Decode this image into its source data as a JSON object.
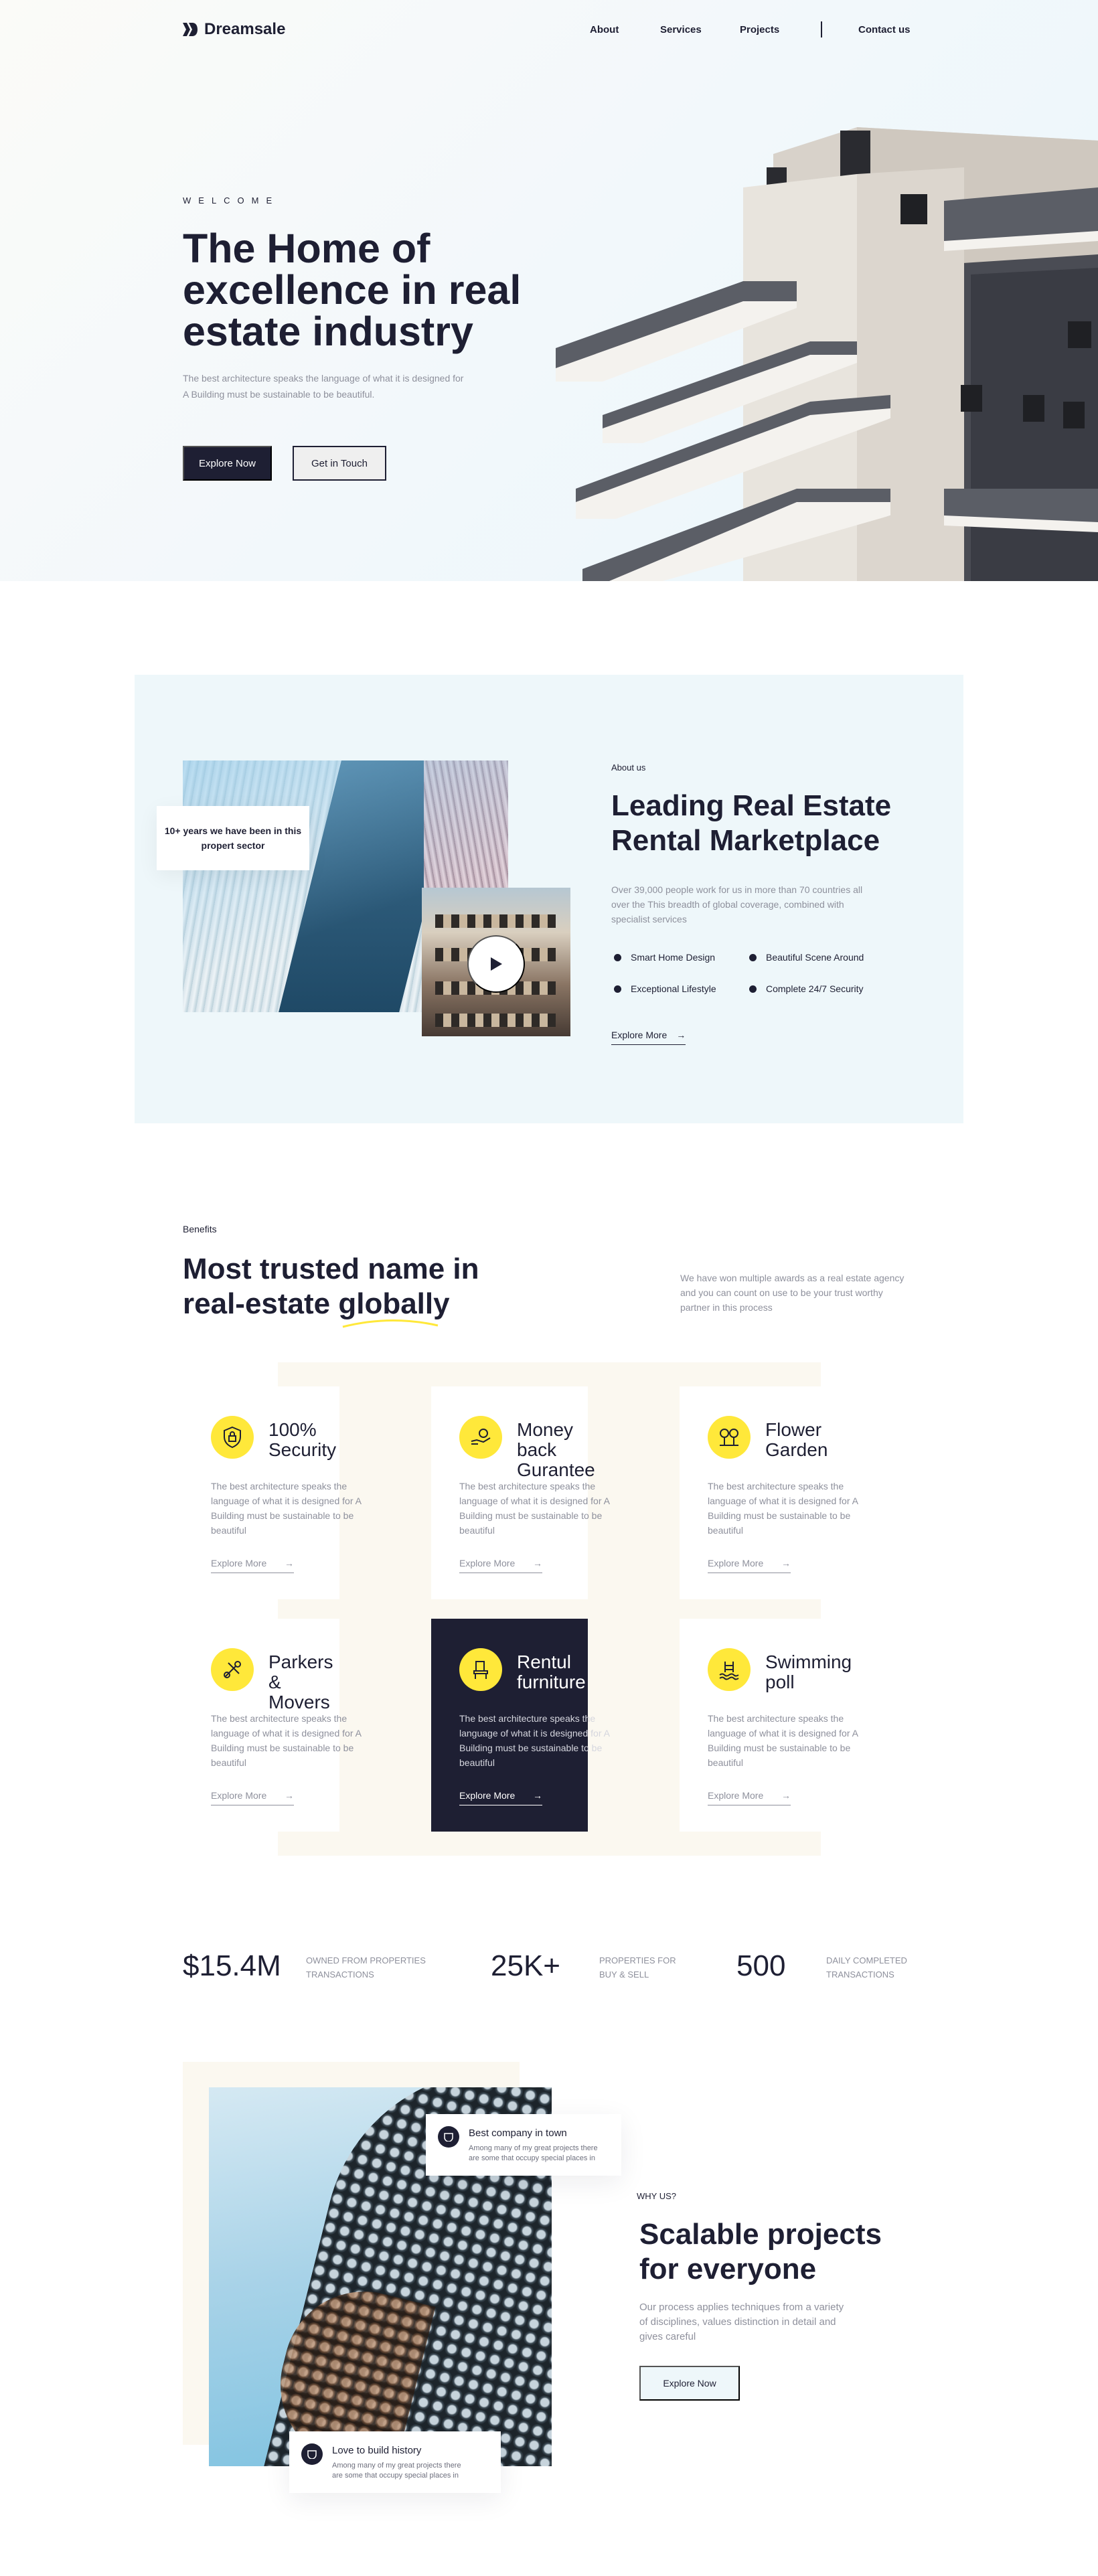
{
  "nav": {
    "brand": "Dreamsale",
    "links": [
      "About",
      "Services",
      "Projects"
    ],
    "contact": "Contact us"
  },
  "hero": {
    "eyebrow": "WELCOME",
    "title": "The Home of excellence in real estate industry",
    "subtitle": "The best architecture speaks the language of what it is designed for A Building must be sustainable to be beautiful.",
    "primary_button": "Explore Now",
    "secondary_button": "Get in Touch"
  },
  "about": {
    "badge": "10+ years we have been in this propert sector",
    "eyebrow": "About us",
    "title": "Leading Real Estate Rental Marketplace",
    "text": "Over 39,000 people work for us in more than 70 countries all over the This breadth of global coverage, combined with specialist services",
    "features": [
      "Smart Home Design",
      "Beautiful Scene Around",
      "Exceptional Lifestyle",
      "Complete 24/7 Security"
    ],
    "explore": "Explore More",
    "arrow": "→"
  },
  "benefits": {
    "eyebrow": "Benefits",
    "title": "Most trusted name in real-estate globally",
    "text": "We have won multiple awards as a real estate agency and you can count on use to be your trust worthy partner in this process",
    "accent": "#ffe83a",
    "cards": [
      {
        "title": "100% Security",
        "icon": "shield-icon",
        "text": "The best architecture speaks the language of what it is designed for A Building must be sustainable to be beautiful",
        "more": "Explore More"
      },
      {
        "title": "Money back Gurantee",
        "icon": "money-hand-icon",
        "text": "The best architecture speaks the language of what it is designed for A Building must be sustainable to be beautiful",
        "more": "Explore More"
      },
      {
        "title": "Flower Garden",
        "icon": "trees-icon",
        "text": "The best architecture speaks the language of what it is designed for A Building must be sustainable to be beautiful",
        "more": "Explore More"
      },
      {
        "title": "Parkers & Movers",
        "icon": "tools-icon",
        "text": "The best architecture speaks the language of what it is designed for A Building must be sustainable to be beautiful",
        "more": "Explore More"
      },
      {
        "title": "Rentul furniture",
        "icon": "chair-icon",
        "text": "The best architecture speaks the language of what it is designed for A Building must be sustainable to be beautiful",
        "more": "Explore More"
      },
      {
        "title": "Swimming poll",
        "icon": "pool-icon",
        "text": "The best architecture speaks the language of what it is designed for A Building must be sustainable to be beautiful",
        "more": "Explore More"
      }
    ]
  },
  "stats": [
    {
      "value": "$15.4M",
      "label": "Owned from properties transactions"
    },
    {
      "value": "25K+",
      "label": "Properties for buy & sell"
    },
    {
      "value": "500",
      "label": "Daily completed transactions"
    }
  ],
  "why": {
    "card_top_title": "Best company in town",
    "card_top_text": "Among many of my great projects there are some that occupy special places in",
    "card_bottom_title": "Love to build history",
    "card_bottom_text": "Among many of my great projects there are some that occupy special places in",
    "eyebrow": "WHY US?",
    "title": "Scalable projects for everyone",
    "text": "Our process applies techniques from a variety of disciplines, values distinction in detail and gives careful",
    "button": "Explore Now"
  }
}
